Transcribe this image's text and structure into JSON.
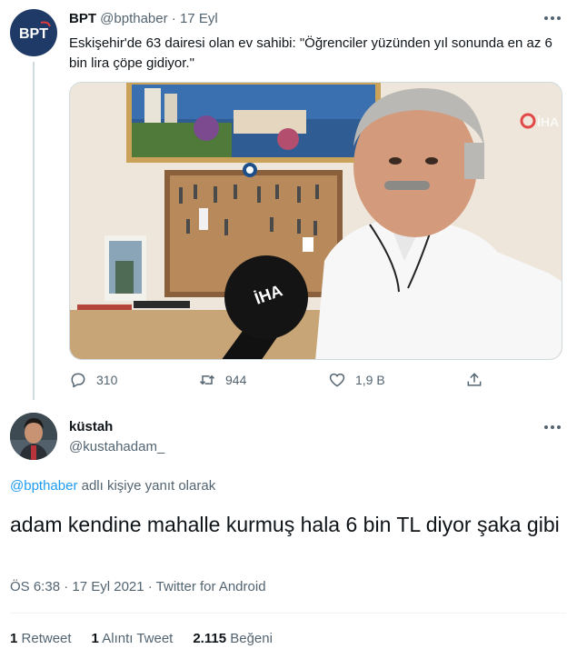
{
  "parent_tweet": {
    "author_name": "BPT",
    "author_handle": "@bpthaber",
    "separator": "·",
    "date": "17 Eyl",
    "avatar_text": "BPT",
    "text": "Eskişehir'de 63 dairesi olan ev sahibi: \"Öğrenciler yüzünden yıl sonunda en az 6 bin lira çöpe gidiyor.\"",
    "media_watermark": "İHA",
    "mic_label": "İHA",
    "actions": {
      "replies": "310",
      "retweets": "944",
      "likes": "1,9 B"
    }
  },
  "reply_tweet": {
    "author_name": "küstah",
    "author_handle": "@kustahadam_",
    "reply_to_handle": "@bpthaber",
    "reply_to_suffix": " adlı kişiye yanıt olarak",
    "text": "adam kendine mahalle kurmuş hala 6 bin TL diyor şaka gibi",
    "meta": "ÖS 6:38 · 17 Eyl 2021 · Twitter for Android",
    "stats": {
      "retweet_count": "1",
      "retweet_label": "Retweet",
      "quote_count": "1",
      "quote_label": "Alıntı Tweet",
      "like_count": "2.115",
      "like_label": "Beğeni"
    }
  },
  "icons": {
    "reply": "reply-icon",
    "retweet": "retweet-icon",
    "like": "heart-icon",
    "share": "share-icon",
    "more": "more-icon"
  },
  "colors": {
    "link": "#1d9bf0",
    "secondary_text": "#536471",
    "primary_text": "#0f1419",
    "bpt_avatar": "#1f3a66"
  }
}
